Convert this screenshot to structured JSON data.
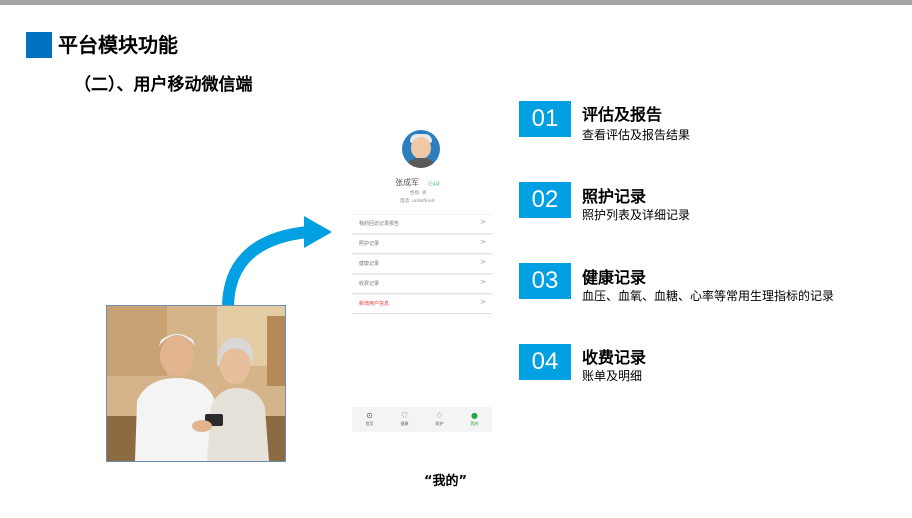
{
  "slide": {
    "title": "平台模块功能",
    "subtitle": "（二）、用户移动微信端",
    "caption": "“我的”"
  },
  "phone": {
    "user_name": "张成军",
    "tag": "已认证",
    "gender": "性别: 男",
    "phone": "电话: undefined",
    "menu": [
      {
        "label": "我的回访记录报告",
        "chevron": ">"
      },
      {
        "label": "照护记录",
        "chevron": ">"
      },
      {
        "label": "健康记录",
        "chevron": ">"
      },
      {
        "label": "收费记录",
        "chevron": ">"
      },
      {
        "label": "新增用户信息",
        "chevron": ">"
      }
    ],
    "tabs": [
      {
        "icon": "⊙",
        "label": "首页"
      },
      {
        "icon": "♡",
        "label": "健康"
      },
      {
        "icon": "♢",
        "label": "照护"
      },
      {
        "icon": "●",
        "label": "我的"
      }
    ]
  },
  "features": [
    {
      "num": "01",
      "title": "评估及报告",
      "desc": "查看评估及报告结果"
    },
    {
      "num": "02",
      "title": "照护记录",
      "desc": "照护列表及详细记录"
    },
    {
      "num": "03",
      "title": "健康记录",
      "desc": "血压、血氧、血糖、心率等常用生理指标的记录"
    },
    {
      "num": "04",
      "title": "收费记录",
      "desc": "账单及明细"
    }
  ],
  "colors": {
    "title_square": "#0070c0",
    "number_box": "#00a0e3",
    "arrow": "#00a0e3",
    "active_tab": "#27a845",
    "alert_text": "#e53935"
  }
}
